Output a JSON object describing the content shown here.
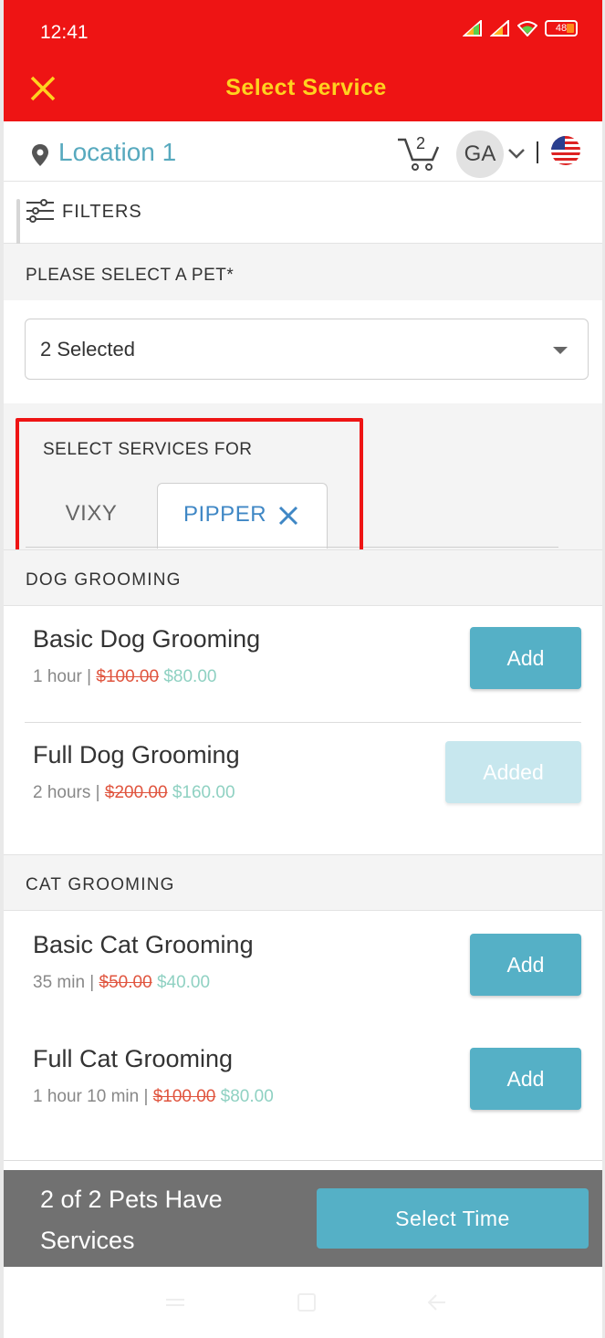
{
  "status_bar": {
    "time": "12:41",
    "battery": "48"
  },
  "app_bar": {
    "title": "Select Service"
  },
  "location_bar": {
    "location": "Location 1",
    "cart_count": "2",
    "avatar_initials": "GA"
  },
  "filters": {
    "label": "FILTERS"
  },
  "pet": {
    "label": "PLEASE SELECT A PET*",
    "selected_value": "2 Selected"
  },
  "services_for": {
    "label": "SELECT SERVICES FOR",
    "tabs": [
      {
        "label": "VIXY"
      },
      {
        "label": "PIPPER"
      }
    ]
  },
  "categories": [
    {
      "title": "DOG GROOMING",
      "services": [
        {
          "name": "Basic Dog Grooming",
          "duration": "1 hour",
          "separator": " | ",
          "old_price": "$100.00",
          "new_price": "$80.00",
          "action": "Add"
        },
        {
          "name": "Full Dog Grooming",
          "duration": "2 hours",
          "separator": " | ",
          "old_price": "$200.00",
          "new_price": "$160.00",
          "action": "Added"
        }
      ]
    },
    {
      "title": "CAT GROOMING",
      "services": [
        {
          "name": "Basic Cat Grooming",
          "duration": "35 min",
          "separator": " | ",
          "old_price": "$50.00",
          "new_price": "$40.00",
          "action": "Add"
        },
        {
          "name": "Full Cat Grooming",
          "duration": "1 hour 10 min",
          "separator": " | ",
          "old_price": "$100.00",
          "new_price": "$80.00",
          "action": "Add"
        }
      ]
    }
  ],
  "bottom_bar": {
    "status": "2 of 2 Pets Have Services",
    "button": "Select Time"
  },
  "colors": {
    "header": "#ee1414",
    "title": "#ffd21f",
    "accent": "#55b0c6",
    "old_price": "#e0553f",
    "new_price": "#8fd1c2"
  },
  "icons": [
    "close-icon",
    "location-pin-icon",
    "cart-icon",
    "chevron-down-icon",
    "us-flag-icon",
    "filter-icon",
    "dropdown-caret-icon",
    "remove-x-icon"
  ]
}
